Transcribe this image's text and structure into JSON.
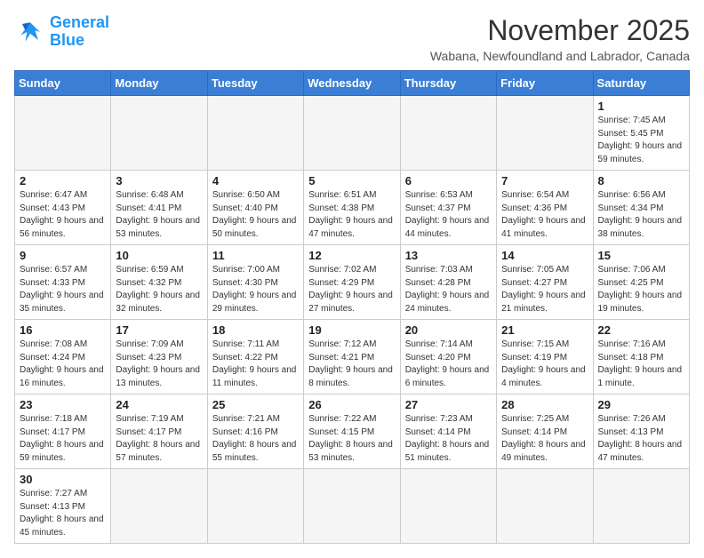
{
  "logo": {
    "line1": "General",
    "line2": "Blue"
  },
  "title": "November 2025",
  "subtitle": "Wabana, Newfoundland and Labrador, Canada",
  "weekdays": [
    "Sunday",
    "Monday",
    "Tuesday",
    "Wednesday",
    "Thursday",
    "Friday",
    "Saturday"
  ],
  "weeks": [
    [
      {
        "day": "",
        "info": ""
      },
      {
        "day": "",
        "info": ""
      },
      {
        "day": "",
        "info": ""
      },
      {
        "day": "",
        "info": ""
      },
      {
        "day": "",
        "info": ""
      },
      {
        "day": "",
        "info": ""
      },
      {
        "day": "1",
        "info": "Sunrise: 7:45 AM\nSunset: 5:45 PM\nDaylight: 9 hours and 59 minutes."
      }
    ],
    [
      {
        "day": "2",
        "info": "Sunrise: 6:47 AM\nSunset: 4:43 PM\nDaylight: 9 hours and 56 minutes."
      },
      {
        "day": "3",
        "info": "Sunrise: 6:48 AM\nSunset: 4:41 PM\nDaylight: 9 hours and 53 minutes."
      },
      {
        "day": "4",
        "info": "Sunrise: 6:50 AM\nSunset: 4:40 PM\nDaylight: 9 hours and 50 minutes."
      },
      {
        "day": "5",
        "info": "Sunrise: 6:51 AM\nSunset: 4:38 PM\nDaylight: 9 hours and 47 minutes."
      },
      {
        "day": "6",
        "info": "Sunrise: 6:53 AM\nSunset: 4:37 PM\nDaylight: 9 hours and 44 minutes."
      },
      {
        "day": "7",
        "info": "Sunrise: 6:54 AM\nSunset: 4:36 PM\nDaylight: 9 hours and 41 minutes."
      },
      {
        "day": "8",
        "info": "Sunrise: 6:56 AM\nSunset: 4:34 PM\nDaylight: 9 hours and 38 minutes."
      }
    ],
    [
      {
        "day": "9",
        "info": "Sunrise: 6:57 AM\nSunset: 4:33 PM\nDaylight: 9 hours and 35 minutes."
      },
      {
        "day": "10",
        "info": "Sunrise: 6:59 AM\nSunset: 4:32 PM\nDaylight: 9 hours and 32 minutes."
      },
      {
        "day": "11",
        "info": "Sunrise: 7:00 AM\nSunset: 4:30 PM\nDaylight: 9 hours and 29 minutes."
      },
      {
        "day": "12",
        "info": "Sunrise: 7:02 AM\nSunset: 4:29 PM\nDaylight: 9 hours and 27 minutes."
      },
      {
        "day": "13",
        "info": "Sunrise: 7:03 AM\nSunset: 4:28 PM\nDaylight: 9 hours and 24 minutes."
      },
      {
        "day": "14",
        "info": "Sunrise: 7:05 AM\nSunset: 4:27 PM\nDaylight: 9 hours and 21 minutes."
      },
      {
        "day": "15",
        "info": "Sunrise: 7:06 AM\nSunset: 4:25 PM\nDaylight: 9 hours and 19 minutes."
      }
    ],
    [
      {
        "day": "16",
        "info": "Sunrise: 7:08 AM\nSunset: 4:24 PM\nDaylight: 9 hours and 16 minutes."
      },
      {
        "day": "17",
        "info": "Sunrise: 7:09 AM\nSunset: 4:23 PM\nDaylight: 9 hours and 13 minutes."
      },
      {
        "day": "18",
        "info": "Sunrise: 7:11 AM\nSunset: 4:22 PM\nDaylight: 9 hours and 11 minutes."
      },
      {
        "day": "19",
        "info": "Sunrise: 7:12 AM\nSunset: 4:21 PM\nDaylight: 9 hours and 8 minutes."
      },
      {
        "day": "20",
        "info": "Sunrise: 7:14 AM\nSunset: 4:20 PM\nDaylight: 9 hours and 6 minutes."
      },
      {
        "day": "21",
        "info": "Sunrise: 7:15 AM\nSunset: 4:19 PM\nDaylight: 9 hours and 4 minutes."
      },
      {
        "day": "22",
        "info": "Sunrise: 7:16 AM\nSunset: 4:18 PM\nDaylight: 9 hours and 1 minute."
      }
    ],
    [
      {
        "day": "23",
        "info": "Sunrise: 7:18 AM\nSunset: 4:17 PM\nDaylight: 8 hours and 59 minutes."
      },
      {
        "day": "24",
        "info": "Sunrise: 7:19 AM\nSunset: 4:17 PM\nDaylight: 8 hours and 57 minutes."
      },
      {
        "day": "25",
        "info": "Sunrise: 7:21 AM\nSunset: 4:16 PM\nDaylight: 8 hours and 55 minutes."
      },
      {
        "day": "26",
        "info": "Sunrise: 7:22 AM\nSunset: 4:15 PM\nDaylight: 8 hours and 53 minutes."
      },
      {
        "day": "27",
        "info": "Sunrise: 7:23 AM\nSunset: 4:14 PM\nDaylight: 8 hours and 51 minutes."
      },
      {
        "day": "28",
        "info": "Sunrise: 7:25 AM\nSunset: 4:14 PM\nDaylight: 8 hours and 49 minutes."
      },
      {
        "day": "29",
        "info": "Sunrise: 7:26 AM\nSunset: 4:13 PM\nDaylight: 8 hours and 47 minutes."
      }
    ],
    [
      {
        "day": "30",
        "info": "Sunrise: 7:27 AM\nSunset: 4:13 PM\nDaylight: 8 hours and 45 minutes."
      },
      {
        "day": "",
        "info": ""
      },
      {
        "day": "",
        "info": ""
      },
      {
        "day": "",
        "info": ""
      },
      {
        "day": "",
        "info": ""
      },
      {
        "day": "",
        "info": ""
      },
      {
        "day": "",
        "info": ""
      }
    ]
  ]
}
